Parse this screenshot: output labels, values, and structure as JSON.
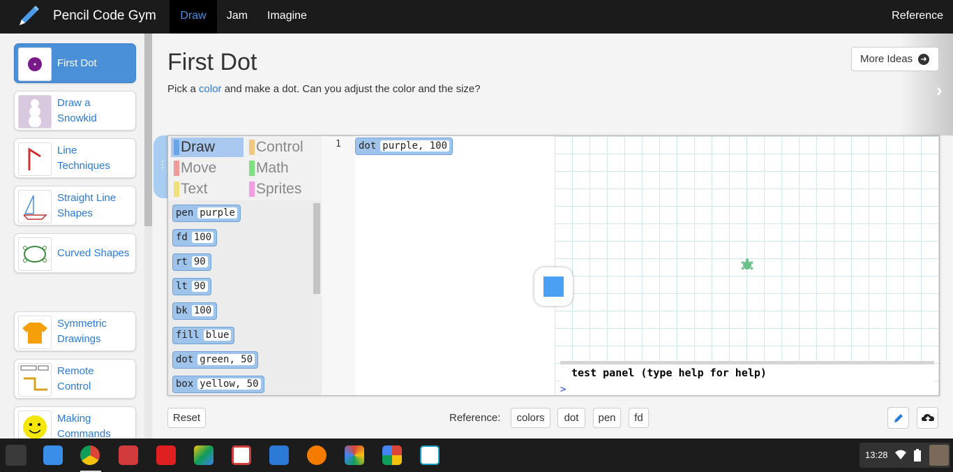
{
  "brand": {
    "title": "Pencil Code Gym"
  },
  "nav": {
    "tabs": [
      {
        "label": "Draw"
      },
      {
        "label": "Jam"
      },
      {
        "label": "Imagine"
      }
    ],
    "reference": "Reference"
  },
  "sidebar": {
    "items": [
      {
        "label1": "First Dot",
        "label2": ""
      },
      {
        "label1": "Draw a",
        "label2": "Snowkid"
      },
      {
        "label1": "Line",
        "label2": "Techniques"
      },
      {
        "label1": "Straight Line",
        "label2": "Shapes"
      },
      {
        "label1": "Curved Shapes",
        "label2": ""
      },
      {
        "label1": "Symmetric",
        "label2": "Drawings"
      },
      {
        "label1": "Remote",
        "label2": "Control"
      },
      {
        "label1": "Making",
        "label2": "Commands"
      }
    ]
  },
  "lesson": {
    "title": "First Dot",
    "desc_before": "Pick a ",
    "desc_link": "color",
    "desc_after": " and make a dot. Can you adjust the color and the size?",
    "more_ideas": "More Ideas"
  },
  "palette": {
    "categories": [
      {
        "label": "Draw",
        "color": "#6aa3e8"
      },
      {
        "label": "Control",
        "color": "#f0c882"
      },
      {
        "label": "Move",
        "color": "#f09a9a"
      },
      {
        "label": "Math",
        "color": "#7ee07e"
      },
      {
        "label": "Text",
        "color": "#f0e07a"
      },
      {
        "label": "Sprites",
        "color": "#f0a0e0"
      }
    ],
    "blocks": [
      {
        "cmd": "pen",
        "args": "purple"
      },
      {
        "cmd": "fd",
        "args": "100"
      },
      {
        "cmd": "rt",
        "args": "90"
      },
      {
        "cmd": "lt",
        "args": "90"
      },
      {
        "cmd": "bk",
        "args": "100"
      },
      {
        "cmd": "fill",
        "args": "blue"
      },
      {
        "cmd": "dot",
        "args": "green, 50"
      },
      {
        "cmd": "box",
        "args": "yellow, 50"
      }
    ]
  },
  "code": {
    "line_number": "1",
    "cmd": "dot",
    "args": "purple, 100"
  },
  "test_panel": {
    "title": "test panel (type help for help)",
    "prompt": ">"
  },
  "footer": {
    "reset": "Reset",
    "reference_label": "Reference:",
    "refs": [
      "colors",
      "dot",
      "pen",
      "fd"
    ]
  },
  "taskbar": {
    "time": "13:28"
  },
  "colors": {
    "accent": "#4a90d9",
    "link": "#2a7ad6",
    "block": "#9fc4ec"
  }
}
